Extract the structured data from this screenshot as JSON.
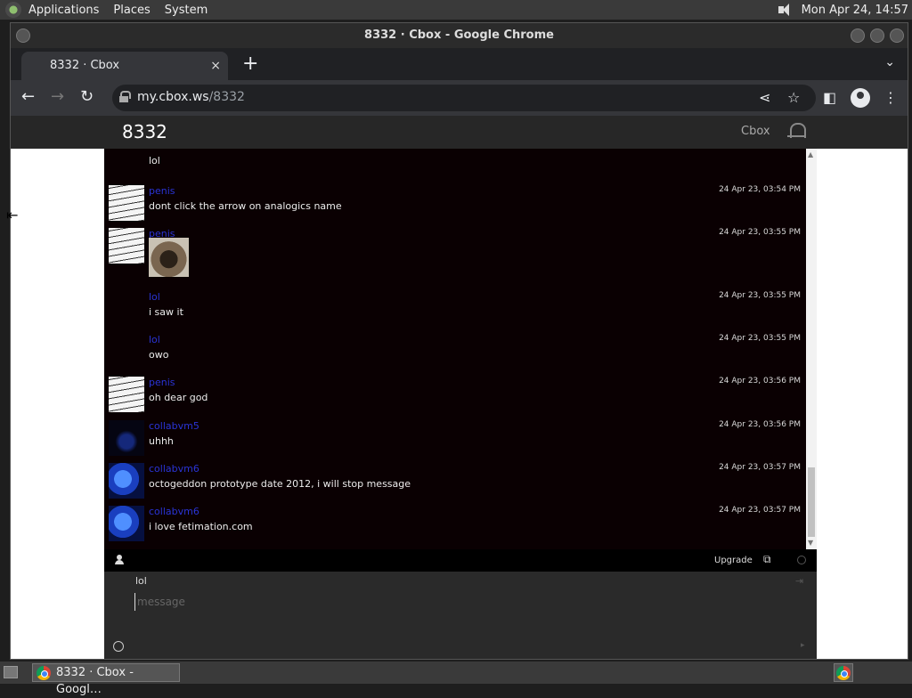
{
  "panel": {
    "menus": [
      "Applications",
      "Places",
      "System"
    ],
    "clock": "Mon Apr 24, 14:57"
  },
  "window": {
    "title": "8332 · Cbox - Google Chrome"
  },
  "tab": {
    "title": "8332 · Cbox",
    "close": "×",
    "new": "+"
  },
  "address": {
    "host": "my.cbox.ws",
    "path": "/8332"
  },
  "site": {
    "title": "8332",
    "brand": "Cbox"
  },
  "messages": [
    {
      "name": "",
      "time": "",
      "text": "lol",
      "avatar": "",
      "partial": true
    },
    {
      "name": "penis",
      "time": "24 Apr 23, 03:54 PM",
      "text": "dont click the arrow on analogics name",
      "avatar": "scribble"
    },
    {
      "name": "penis",
      "time": "24 Apr 23, 03:55 PM",
      "text": "",
      "avatar": "scribble",
      "image": true
    },
    {
      "name": "lol",
      "time": "24 Apr 23, 03:55 PM",
      "text": "i saw it",
      "avatar": ""
    },
    {
      "name": "lol",
      "time": "24 Apr 23, 03:55 PM",
      "text": "owo",
      "avatar": ""
    },
    {
      "name": "penis",
      "time": "24 Apr 23, 03:56 PM",
      "text": "oh dear god",
      "avatar": "scribble"
    },
    {
      "name": "collabvm5",
      "time": "24 Apr 23, 03:56 PM",
      "text": "uhhh",
      "avatar": "dark"
    },
    {
      "name": "collabvm6",
      "time": "24 Apr 23, 03:57 PM",
      "text": "octogeddon prototype date 2012, i will stop message",
      "avatar": "blue"
    },
    {
      "name": "collabvm6",
      "time": "24 Apr 23, 03:57 PM",
      "text": "i love fetimation.com",
      "avatar": "blue"
    }
  ],
  "status": {
    "upgrade": "Upgrade"
  },
  "composer": {
    "name_value": "lol",
    "placeholder": "message"
  },
  "taskbar": {
    "item": "8332 · Cbox - Googl…"
  },
  "colors": {
    "chat_bg": "#0a0002",
    "username": "#2a34d6",
    "header_bg": "#272727"
  }
}
